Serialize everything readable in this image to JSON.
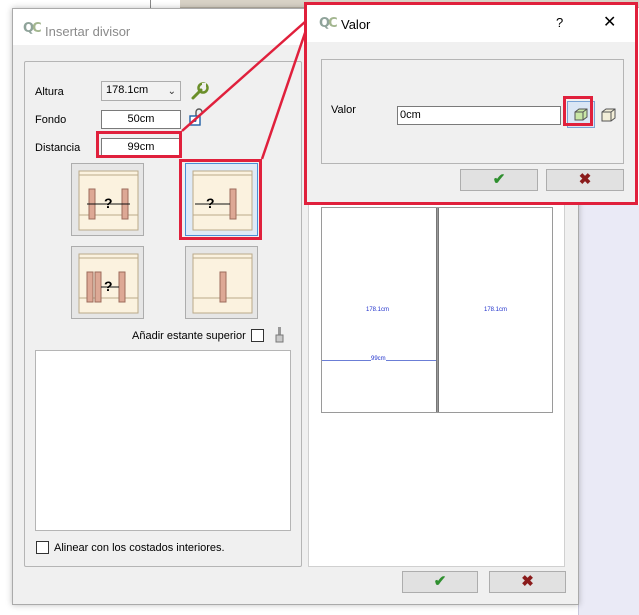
{
  "main_dialog": {
    "title": "Insertar divisor",
    "logo_text": "QC",
    "fields": {
      "altura_label": "Altura",
      "altura_value": "178.1cm",
      "fondo_label": "Fondo",
      "fondo_value": "50cm",
      "distancia_label": "Distancia",
      "distancia_value": "99cm"
    },
    "add_top_shelf_label": "Añadir estante superior",
    "align_label": "Alinear con los costados interiores.",
    "ok_icon": "check-icon",
    "cancel_icon": "cross-icon"
  },
  "preview": {
    "left_height": "178.1cm",
    "right_height": "178.1cm",
    "width": "99cm"
  },
  "valor_dialog": {
    "title": "Valor",
    "logo_text": "QC",
    "help": "?",
    "close": "✕",
    "field_label": "Valor",
    "field_value": "0cm"
  },
  "colors": {
    "highlight": "#e0203c",
    "ok_green": "#2f8f2f",
    "cancel_red": "#8a1b1b",
    "selection_blue": "#4a8ed6"
  }
}
